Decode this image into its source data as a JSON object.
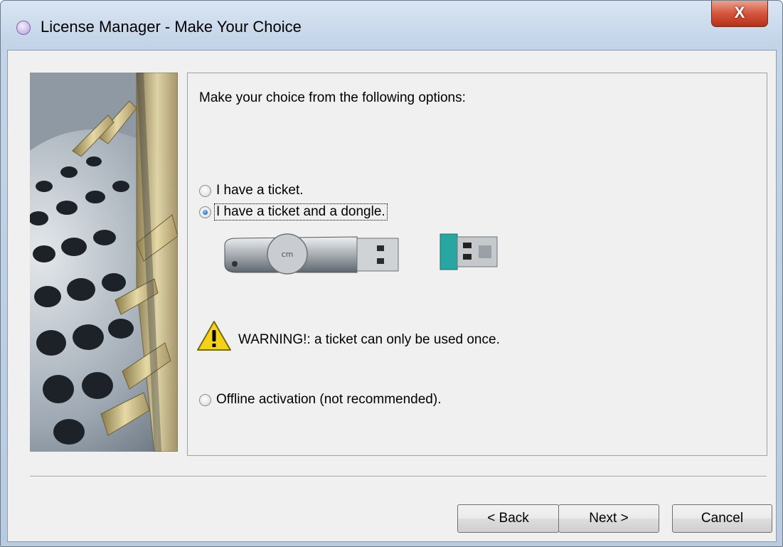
{
  "window": {
    "title": "License Manager - Make Your Choice",
    "close_label": "X"
  },
  "content": {
    "prompt": "Make your choice from the following options:",
    "options": [
      {
        "label": "I have a ticket.",
        "checked": false
      },
      {
        "label": "I have a ticket and a dongle.",
        "checked": true
      },
      {
        "label": "Offline activation (not recommended).",
        "checked": false
      }
    ],
    "warning": "WARNING!: a ticket can only be used once."
  },
  "buttons": {
    "back": "< Back",
    "next": "Next >",
    "cancel": "Cancel"
  },
  "colors": {
    "close_red": "#d5553c",
    "radio_selected": "#1f6fc9",
    "warning_yellow": "#f5d21a"
  }
}
